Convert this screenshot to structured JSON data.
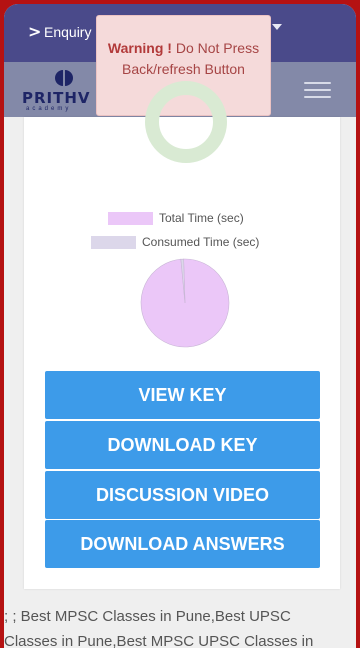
{
  "enquiry": {
    "label": "Enquiry"
  },
  "logo": {
    "text": "PRITHV",
    "subtext": "academy"
  },
  "toast": {
    "title": "Warning !",
    "message": " Do Not Press Back/refresh Button"
  },
  "legend": [
    {
      "label": "Total Time (sec)",
      "color": "#ebc7f8"
    },
    {
      "label": "Consumed Time (sec)",
      "color": "#dcd7ea"
    }
  ],
  "donut_color": "#d9ead3",
  "chart_data": {
    "type": "pie",
    "categories": [
      "Total Time (sec)",
      "Consumed Time (sec)"
    ],
    "values": [
      99,
      1
    ],
    "colors": [
      "#ebc7f8",
      "#dcd7ea"
    ]
  },
  "buttons": {
    "view_key": "VIEW KEY",
    "download_key": "DOWNLOAD KEY",
    "discussion_video": "DISCUSSION VIDEO",
    "download_answers": "DOWNLOAD ANSWERS"
  },
  "footer": {
    "line1": "; ; Best MPSC Classes in Pune,Best UPSC",
    "line2": "Classes in Pune,Best MPSC UPSC Classes in"
  }
}
